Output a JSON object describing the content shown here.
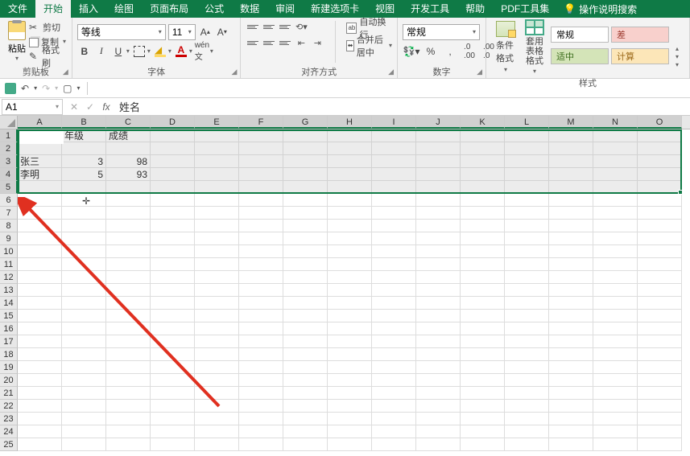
{
  "menu": {
    "file": "文件",
    "home": "开始",
    "insert": "插入",
    "draw": "绘图",
    "pagelayout": "页面布局",
    "formulas": "公式",
    "data": "数据",
    "review": "审阅",
    "newtab": "新建选项卡",
    "view": "视图",
    "developer": "开发工具",
    "help": "帮助",
    "pdf": "PDF工具集",
    "tellme": "操作说明搜索"
  },
  "clipboard": {
    "paste": "粘贴",
    "cut": "剪切",
    "copy": "复制",
    "format_painter": "格式刷",
    "group": "剪贴板"
  },
  "font": {
    "name": "等线",
    "size": "11",
    "group": "字体"
  },
  "alignment": {
    "wrap": "自动换行",
    "merge": "合并后居中",
    "group": "对齐方式"
  },
  "number": {
    "format": "常规",
    "group": "数字"
  },
  "styles": {
    "cond": "条件格式",
    "table": "套用\n表格格式",
    "normal": "常规",
    "bad": "差",
    "good": "适中",
    "calc": "计算",
    "group": "样式"
  },
  "namebox": "A1",
  "formula": "姓名",
  "columns": [
    "A",
    "B",
    "C",
    "D",
    "E",
    "F",
    "G",
    "H",
    "I",
    "J",
    "K",
    "L",
    "M",
    "N",
    "O"
  ],
  "row_count": 25,
  "sheet": {
    "r1": {
      "a": "姓名",
      "b": "年级",
      "c": "成绩"
    },
    "r3": {
      "a": "张三",
      "b": "3",
      "c": "98"
    },
    "r4": {
      "a": "李明",
      "b": "5",
      "c": "93"
    }
  }
}
